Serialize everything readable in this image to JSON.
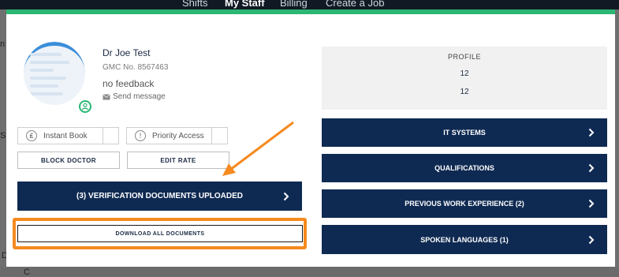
{
  "topnav": {
    "items": [
      "Shifts",
      "My Staff",
      "Billing",
      "Create a Job"
    ],
    "active": "My Staff"
  },
  "background": {
    "left_fragments": [
      "n",
      "St",
      "D",
      "C"
    ]
  },
  "doctor": {
    "name": "Dr Joe Test",
    "gmc": "GMC No. 8567463",
    "feedback": "no feedback",
    "send_message": "Send message"
  },
  "actions": {
    "instant_book": "Instant Book",
    "priority_access": "Priority Access",
    "block_doctor": "BLOCK DOCTOR",
    "edit_rate": "EDIT RATE",
    "verification": "(3) VERIFICATION DOCUMENTS UPLOADED",
    "download_all": "DOWNLOAD ALL DOCUMENTS"
  },
  "profile": {
    "title": "PROFILE",
    "value_1": "12",
    "value_2": "12"
  },
  "sections": [
    {
      "label": "IT SYSTEMS"
    },
    {
      "label": "QUALIFICATIONS"
    },
    {
      "label": "PREVIOUS WORK EXPERIENCE (2)"
    },
    {
      "label": "SPOKEN LANGUAGES (1)"
    }
  ],
  "colors": {
    "navy": "#0f2a52",
    "accent_green": "#2bb673",
    "highlight_orange": "#f58a1f"
  }
}
